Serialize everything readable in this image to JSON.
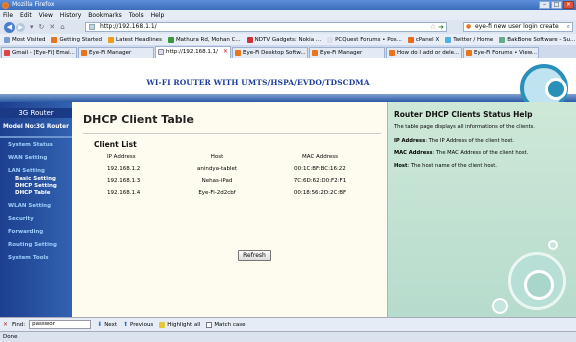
{
  "window": {
    "title": "Mozilla Firefox",
    "buttons": [
      "–",
      "□",
      "×"
    ]
  },
  "menubar": [
    "File",
    "Edit",
    "View",
    "History",
    "Bookmarks",
    "Tools",
    "Help"
  ],
  "navigation": {
    "url": "http://192.168.1.1/",
    "search_value": "eye-fi new user login create"
  },
  "bookmarks": [
    "Most Visited",
    "Getting Started",
    "Latest Headlines",
    "Mathura Rd, Mohan C...",
    "NDTV Gadgets: Nokia ...",
    "PCQuest Forums • Pos...",
    "cPanel X",
    "Twitter / Home",
    "BakBone Software - Su..."
  ],
  "tabs": [
    {
      "label": "Gmail - [Eye-Fi] Emai...",
      "active": false,
      "icon": "gmail"
    },
    {
      "label": "Eye-Fi Manager",
      "active": false,
      "icon": "eyefi"
    },
    {
      "label": "http://192.168.1.1/",
      "active": true,
      "icon": "page"
    },
    {
      "label": "Eye-Fi Desktop Softw...",
      "active": false,
      "icon": "eyefi"
    },
    {
      "label": "Eye-Fi Manager",
      "active": false,
      "icon": "eyefi"
    },
    {
      "label": "How do I add or dele...",
      "active": false,
      "icon": "eyefi"
    },
    {
      "label": "Eye-Fi Forums • View...",
      "active": false,
      "icon": "eyefi"
    }
  ],
  "router": {
    "banner": "WI-FI ROUTER WITH UMTS/HSPA/EVDO/TDSCDMA",
    "sidebar": {
      "brand": "3G Router",
      "model": "Model No:3G Router",
      "items": [
        {
          "label": "System Status",
          "sub": false
        },
        {
          "label": "WAN Setting",
          "sub": false
        },
        {
          "label": "LAN Setting",
          "sub": false
        },
        {
          "label": "Basic Setting",
          "sub": true
        },
        {
          "label": "DHCP Setting",
          "sub": true
        },
        {
          "label": "DHCP Table",
          "sub": true
        },
        {
          "label": "WLAN Setting",
          "sub": false
        },
        {
          "label": "Security",
          "sub": false
        },
        {
          "label": "Forwarding",
          "sub": false
        },
        {
          "label": "Routing Setting",
          "sub": false
        },
        {
          "label": "System Tools",
          "sub": false
        }
      ]
    },
    "main": {
      "title": "DHCP Client Table",
      "list_title": "Client List",
      "columns": [
        "IP Address",
        "Host",
        "MAC Address"
      ],
      "rows": [
        {
          "ip": "192.168.1.2",
          "host": "anindya-tablet",
          "mac": "00:1C:BF:BC:16:22"
        },
        {
          "ip": "192.168.1.3",
          "host": "Nehas-iPad",
          "mac": "7C:6D:62:D0:F2:F1"
        },
        {
          "ip": "192.168.1.4",
          "host": "Eye-Fi-2d2cbf",
          "mac": "00:18:56:2D:2C:BF"
        }
      ],
      "refresh_label": "Refresh"
    },
    "help": {
      "title": "Router DHCP Clients Status Help",
      "intro": "The table page displays all informations of the clients.",
      "ip_term": "IP Address",
      "ip_desc": ": The IP Address of the client host.",
      "mac_term": "MAC Address",
      "mac_desc": ": The MAC Address of the client host.",
      "host_term": "Host",
      "host_desc": ": The host name of the client host."
    }
  },
  "findbar": {
    "label": "Find:",
    "value": "passwor",
    "next": "Next",
    "previous": "Previous",
    "highlight": "Highlight all",
    "match_case": "Match case"
  },
  "status": "Done"
}
